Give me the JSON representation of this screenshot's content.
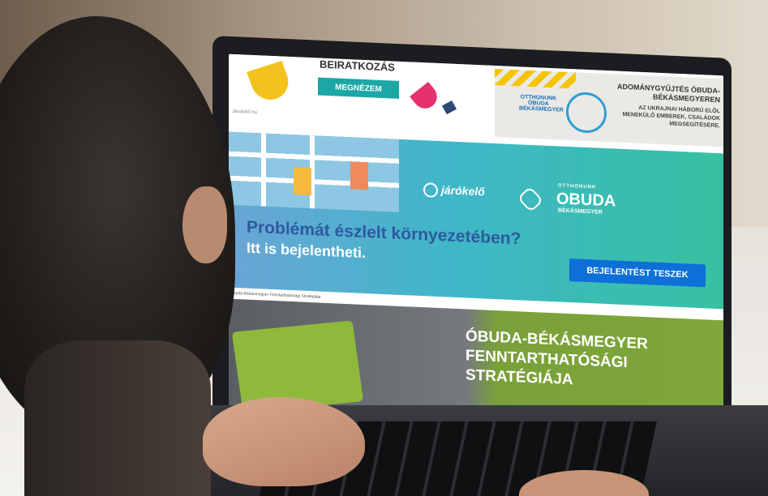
{
  "top_banner": {
    "heading": "BEIRATKOZÁS",
    "button": "MEGNÉZEM",
    "source": "Járókelő.hu"
  },
  "ad": {
    "title": "ADOMÁNYGYŰJTÉS ÓBUDA-BÉKÁSMEGYEREN",
    "subtitle": "AZ UKRAJNAI HÁBORÚ ELŐL MENEKÜLŐ EMBEREK, CSALÁDOK MEGSEGÍTÉSÉRE.",
    "logo1": "OTTHONUNK ÓBUDA BÉKÁSMEGYER"
  },
  "main_banner": {
    "brand": "járókelő",
    "partner_small": "OTTHONUNK",
    "partner_big": "OBUDA",
    "partner_sub": "BÉKÁSMEGYER",
    "question": "Problémát észlelt környezetében?",
    "question_line2": "Itt is bejelentheti.",
    "button": "BEJELENTÉST TESZEK",
    "caption": "Óbuda-Békásmegyer Fenntarthatósági Stratégiája"
  },
  "strategy_banner": {
    "line1": "ÓBUDA-BÉKÁSMEGYER",
    "line2": "FENNTARTHATÓSÁGI",
    "line3": "STRATÉGIÁJA"
  }
}
